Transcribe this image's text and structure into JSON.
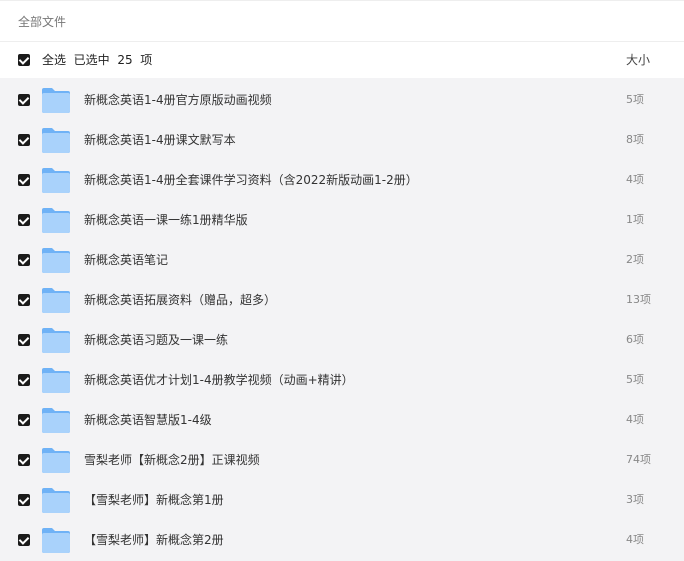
{
  "breadcrumb": "全部文件",
  "header": {
    "select_all_label": "全选",
    "selected_prefix": "已选中",
    "selected_count": "25",
    "selected_suffix": "项",
    "size_column": "大小"
  },
  "folders": [
    {
      "name": "新概念英语1-4册官方原版动画视频",
      "count": "5项",
      "checked": true
    },
    {
      "name": "新概念英语1-4册课文默写本",
      "count": "8项",
      "checked": true
    },
    {
      "name": "新概念英语1-4册全套课件学习资料（含2022新版动画1-2册）",
      "count": "4项",
      "checked": true
    },
    {
      "name": "新概念英语一课一练1册精华版",
      "count": "1项",
      "checked": true
    },
    {
      "name": "新概念英语笔记",
      "count": "2项",
      "checked": true
    },
    {
      "name": "新概念英语拓展资料（赠品，超多）",
      "count": "13项",
      "checked": true
    },
    {
      "name": "新概念英语习题及一课一练",
      "count": "6项",
      "checked": true
    },
    {
      "name": "新概念英语优才计划1-4册教学视频（动画+精讲）",
      "count": "5项",
      "checked": true
    },
    {
      "name": "新概念英语智慧版1-4级",
      "count": "4项",
      "checked": true
    },
    {
      "name": "雪梨老师【新概念2册】正课视频",
      "count": "74项",
      "checked": true
    },
    {
      "name": "【雪梨老师】新概念第1册",
      "count": "3项",
      "checked": true
    },
    {
      "name": "【雪梨老师】新概念第2册",
      "count": "4项",
      "checked": true
    }
  ],
  "icons": {
    "checkbox": "checkbox-checked-icon",
    "folder": "folder-icon"
  },
  "colors": {
    "checkbox": "#1a1a1a",
    "folder_light": "#a9d2fb",
    "folder_dark": "#6fb2f6",
    "list_background": "#f3f3f5"
  }
}
